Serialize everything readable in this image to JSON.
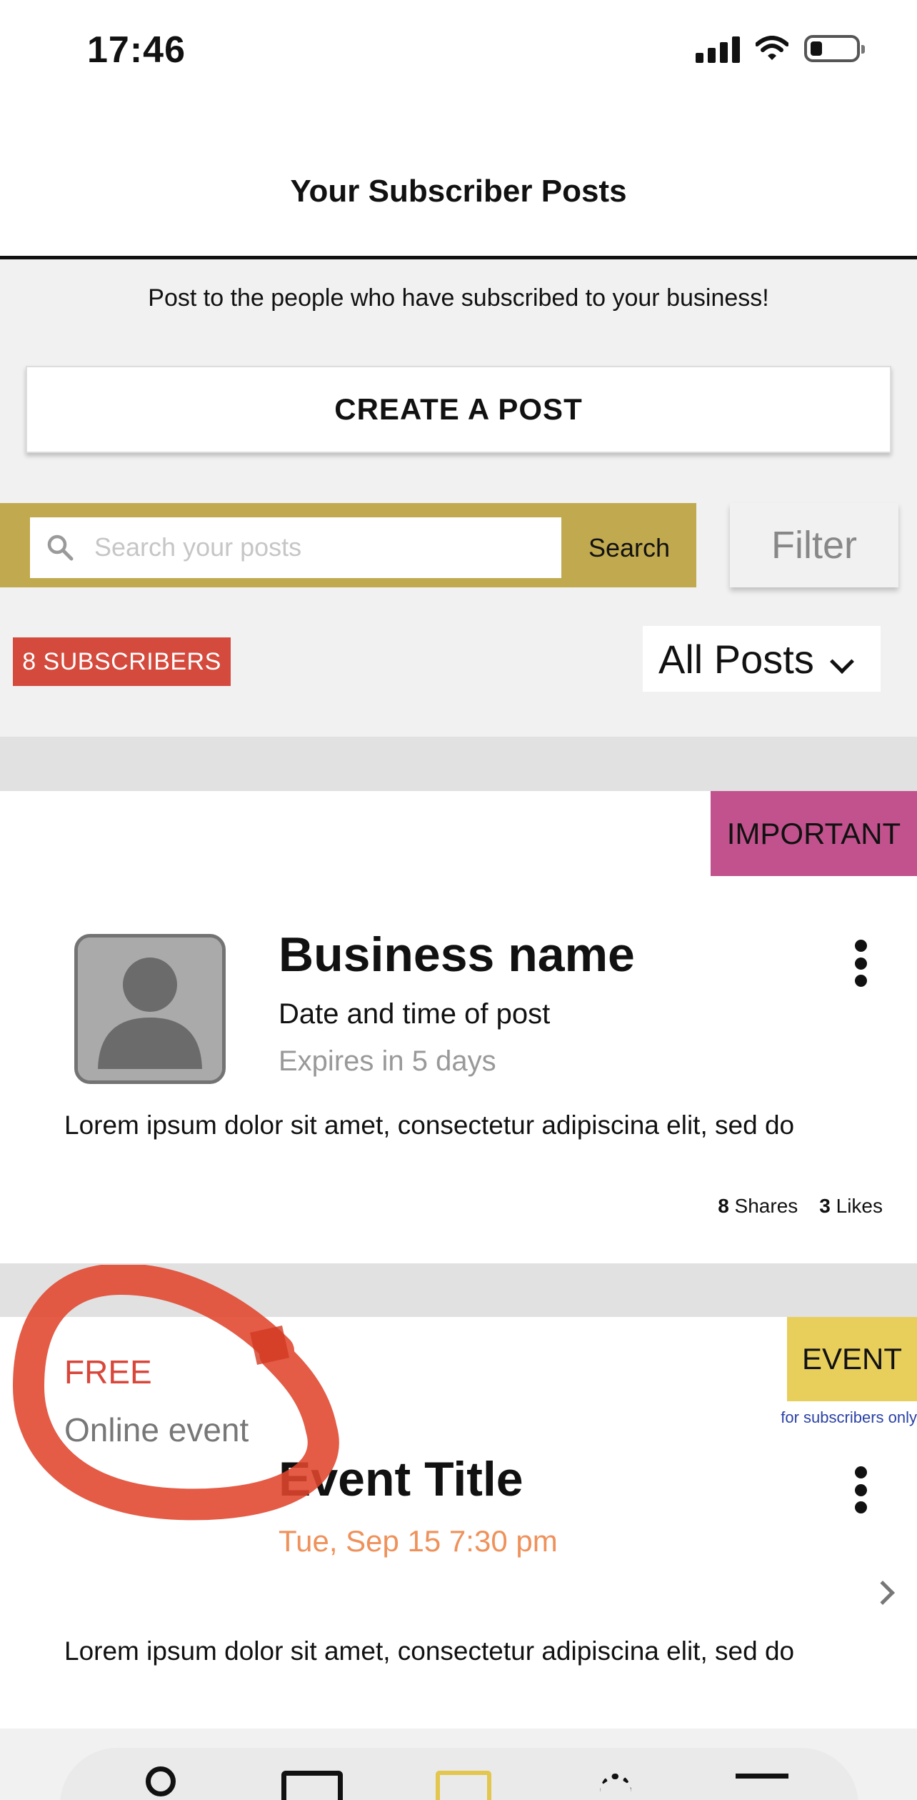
{
  "status_bar": {
    "time": "17:46",
    "icons": [
      "signal-icon",
      "wifi-icon",
      "battery-icon"
    ]
  },
  "header": {
    "title": "Your Subscriber Posts"
  },
  "intro": {
    "text": "Post to the people who have subscribed to your business!"
  },
  "create_post": {
    "label": "CREATE A POST"
  },
  "search": {
    "placeholder": "Search your posts",
    "value": "",
    "button_label": "Search"
  },
  "filter": {
    "label": "Filter"
  },
  "subscribers": {
    "label": "8 SUBSCRIBERS"
  },
  "posts_filter": {
    "selected": "All Posts"
  },
  "posts": [
    {
      "tag": "IMPORTANT",
      "business_name": "Business name",
      "date": "Date and time of post",
      "expires": "Expires in 5 days",
      "body": "Lorem ipsum dolor sit amet, consectetur adipiscina elit, sed do",
      "shares_count": "8",
      "shares_label": "Shares",
      "likes_count": "3",
      "likes_label": "Likes"
    },
    {
      "tag": "EVENT",
      "tag_note": "for subscribers only",
      "price": "FREE",
      "location": "Online event",
      "title": "Event Title",
      "date": "Tue, Sep 15 7:30 pm",
      "body": "Lorem ipsum dolor sit amet, consectetur adipiscina elit, sed do"
    }
  ],
  "colors": {
    "search_bar": "#c0a94e",
    "subscribers_badge": "#d44a3d",
    "important_tag": "#c2528d",
    "event_tag": "#e8cf5c",
    "event_date": "#ef915a",
    "price": "#d9463a",
    "annotation": "#e0442c"
  },
  "bottom_nav": {
    "items": [
      "profile-icon",
      "mail-icon",
      "posts-icon",
      "ideas-icon",
      "menu-icon"
    ],
    "active": "posts-icon"
  }
}
